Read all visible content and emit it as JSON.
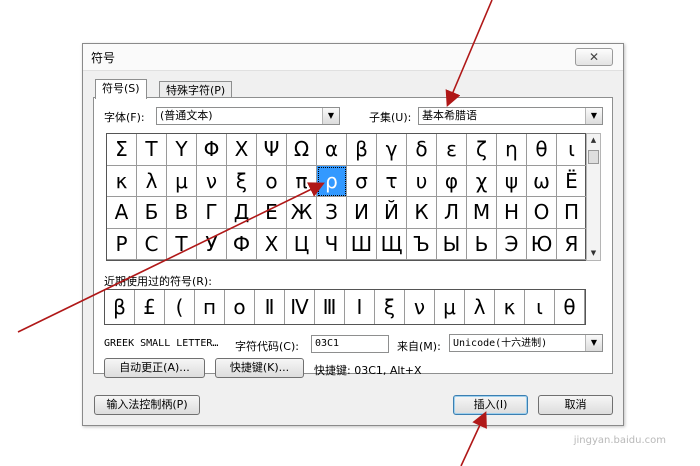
{
  "dialog": {
    "title": "符号",
    "close_glyph": "✕"
  },
  "tabs": [
    {
      "label": "符号(S)"
    },
    {
      "label": "特殊字符(P)"
    }
  ],
  "font": {
    "label": "字体(F):",
    "value": "(普通文本)"
  },
  "subset": {
    "label": "子集(U):",
    "value": "基本希腊语"
  },
  "symbol_grid": {
    "rows": [
      [
        "Σ",
        "Τ",
        "Υ",
        "Φ",
        "Χ",
        "Ψ",
        "Ω",
        "α",
        "β",
        "γ",
        "δ",
        "ε",
        "ζ",
        "η",
        "θ",
        "ι"
      ],
      [
        "κ",
        "λ",
        "μ",
        "ν",
        "ξ",
        "ο",
        "π",
        "ρ",
        "σ",
        "τ",
        "υ",
        "φ",
        "χ",
        "ψ",
        "ω",
        "Ё"
      ],
      [
        "А",
        "Б",
        "В",
        "Г",
        "Д",
        "Е",
        "Ж",
        "З",
        "И",
        "Й",
        "К",
        "Л",
        "М",
        "Н",
        "О",
        "П"
      ],
      [
        "Р",
        "С",
        "Т",
        "У",
        "Ф",
        "Х",
        "Ц",
        "Ч",
        "Ш",
        "Щ",
        "Ъ",
        "Ы",
        "Ь",
        "Э",
        "Ю",
        "Я"
      ]
    ],
    "selected": "ρ"
  },
  "recent": {
    "label": "近期使用过的符号(R):",
    "symbols": [
      "β",
      "£",
      "(",
      "п",
      "о",
      "Ⅱ",
      "Ⅳ",
      "Ⅲ",
      "Ι",
      "ξ",
      "ν",
      "μ",
      "λ",
      "κ",
      "ι",
      "θ"
    ]
  },
  "char_name": "GREEK SMALL LETTER…",
  "char_code": {
    "label": "字符代码(C):",
    "value": "03C1"
  },
  "from": {
    "label": "来自(M):",
    "value": "Unicode(十六进制)"
  },
  "buttons": {
    "autocorrect": "自动更正(A)...",
    "shortcut_key": "快捷键(K)...",
    "ime": "输入法控制柄(P)",
    "insert": "插入(I)",
    "cancel": "取消"
  },
  "shortcut_text": "快捷键: 03C1, Alt+X",
  "watermark": "jingyan.baidu.com",
  "colors": {
    "selection": "#3399ff",
    "annotation_arrow": "#b01818"
  }
}
